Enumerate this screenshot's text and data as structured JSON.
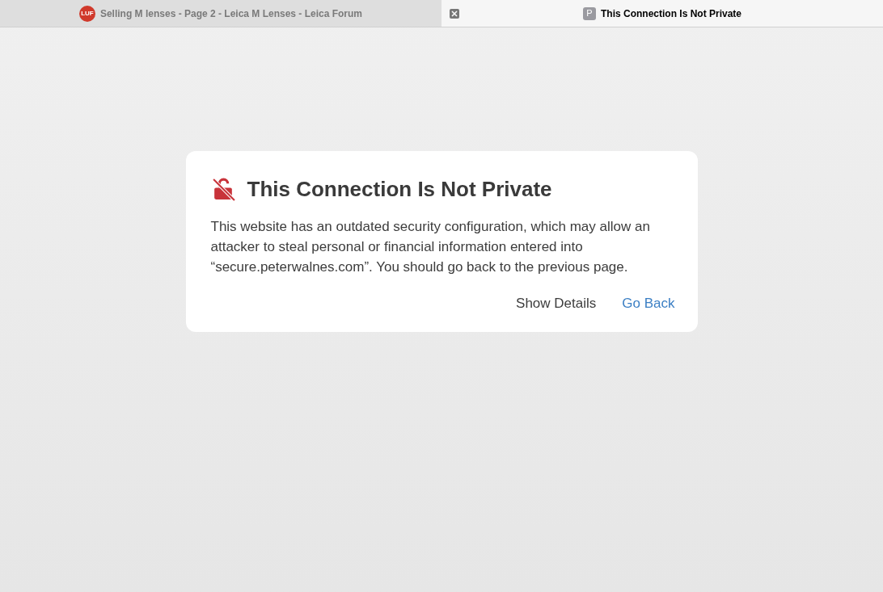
{
  "tabs": [
    {
      "favicon": "LUF",
      "title": "Selling M lenses - Page 2 - Leica M Lenses - Leica Forum",
      "selected": false
    },
    {
      "favicon": "P",
      "title": "This Connection Is Not Private",
      "selected": true
    }
  ],
  "warning": {
    "title": "This Connection Is Not Private",
    "message": "This website has an outdated security configuration, which may allow an attacker to steal personal or financial information entered into “secure.peterwalnes.com”. You should go back to the previous page.",
    "buttons": [
      {
        "label": "Show Details",
        "kind": "secondary"
      },
      {
        "label": "Go Back",
        "kind": "primary"
      }
    ]
  }
}
